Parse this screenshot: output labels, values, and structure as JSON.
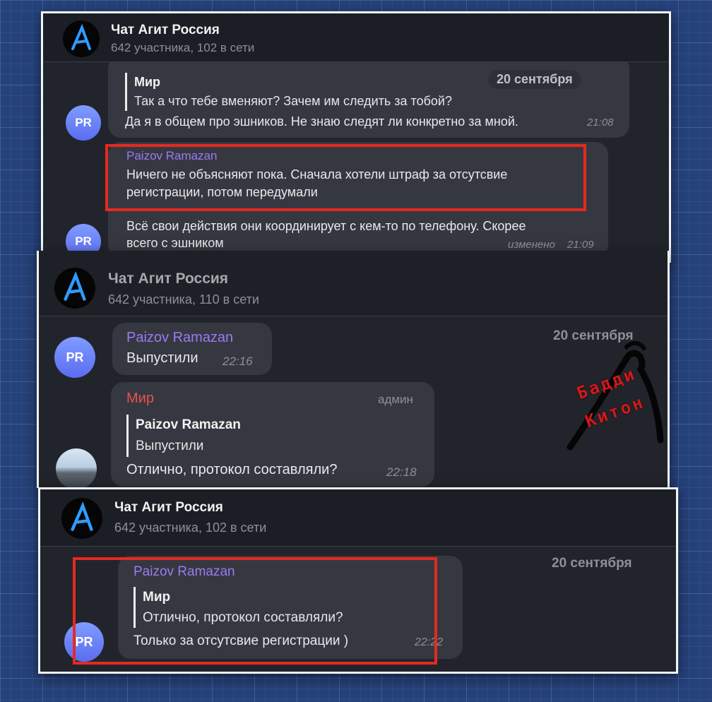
{
  "screens": [
    {
      "header": {
        "title": "Чат Агит Россия",
        "subtitle": "642 участника, 102 в сети"
      },
      "date": "20 сентября",
      "messages": [
        {
          "reply_name": "Мир",
          "reply_text": "Так а что тебе вменяют? Зачем им следить за тобой?",
          "text": "Да я в общем про эшников. Не знаю следят ли конкретно за мной.",
          "time": "21:08",
          "avatar": "PR"
        },
        {
          "sender": "Paizov Ramazan",
          "text_lines": [
            "Ничего не объясняют пока. Сначала хотели штраф за отсутсвие",
            "регистрации, потом передумали"
          ]
        },
        {
          "text_lines": [
            "Всё свои действия они координирует с кем-то по телефону.  Скорее",
            "всего с эшником"
          ],
          "edited": "изменено",
          "time": "21:09",
          "avatar": "PR"
        }
      ]
    },
    {
      "header": {
        "title": "Чат Агит Россия",
        "subtitle": "642 участника, 110 в сети"
      },
      "date": "20 сентября",
      "messages": [
        {
          "sender": "Paizov Ramazan",
          "text": "Выпустили",
          "time": "22:16",
          "avatar": "PR"
        },
        {
          "sender": "Мир",
          "role": "админ",
          "reply_name": "Paizov Ramazan",
          "reply_text": "Выпустили",
          "text": "Отлично, протокол составляли?",
          "time": "22:18"
        }
      ],
      "watermark": {
        "line1": "Бадди",
        "line2": "Китон"
      }
    },
    {
      "header": {
        "title": "Чат Агит Россия",
        "subtitle": "642 участника, 102 в сети"
      },
      "date": "20 сентября",
      "messages": [
        {
          "sender": "Paizov Ramazan",
          "reply_name": "Мир",
          "reply_text": "Отлично, протокол составляли?",
          "text": "Только за отсутсвие регистрации )",
          "time": "22:22",
          "avatar": "PR"
        }
      ]
    }
  ],
  "colors": {
    "accent_name": "#9b7af2",
    "admin_name": "#e5534b",
    "highlight": "#e52a20"
  },
  "icons": {
    "logo": "anarchy-a-logo"
  }
}
